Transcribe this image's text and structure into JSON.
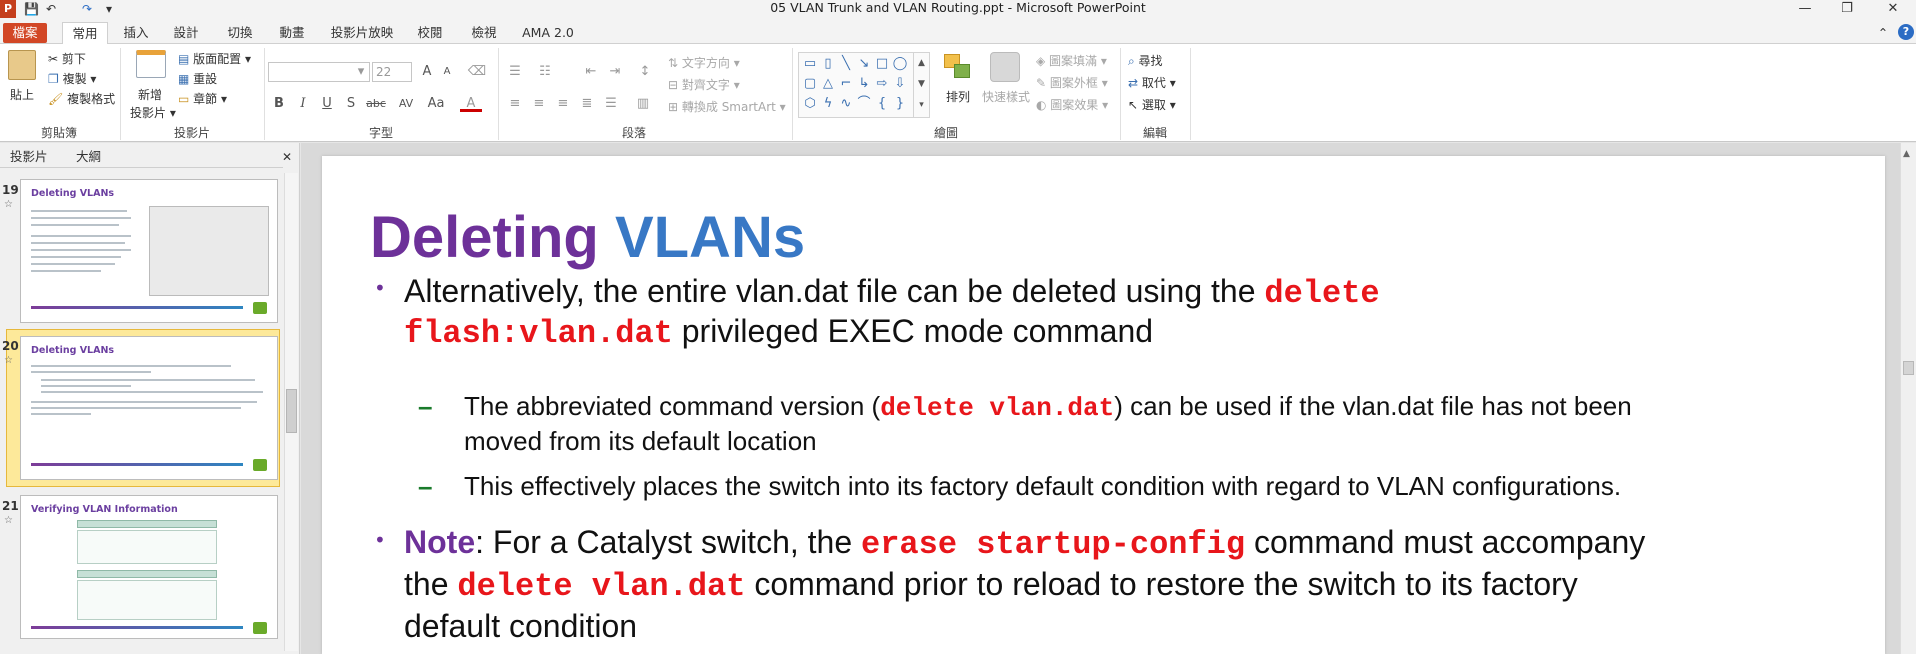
{
  "window": {
    "title": "05 VLAN Trunk and VLAN Routing.ppt - Microsoft PowerPoint",
    "min_glyph": "—",
    "restore_glyph": "❐",
    "close_glyph": "✕"
  },
  "qat": {
    "logo": "P",
    "save": "💾",
    "undo": "↶",
    "redo": "↷",
    "customize": "▾"
  },
  "tabs": {
    "file": "檔案",
    "home": "常用",
    "insert": "插入",
    "design": "設計",
    "transitions": "切換",
    "animations": "動畫",
    "slideshow": "投影片放映",
    "review": "校閱",
    "view": "檢視",
    "ama": "AMA 2.0",
    "ribbon_toggle": "⌃",
    "help": "?"
  },
  "clipboard": {
    "paste": "貼上",
    "cut": "剪下",
    "copy": "複製",
    "format_painter": "複製格式",
    "group": "剪貼簿"
  },
  "slides_group": {
    "new_slide_1": "新增",
    "new_slide_2": "投影片",
    "layout": "版面配置",
    "reset": "重設",
    "section": "章節",
    "group": "投影片"
  },
  "font": {
    "name_value": "",
    "size_value": "22",
    "bold": "B",
    "italic": "I",
    "underline": "U",
    "shadow": "S",
    "strike": "abc",
    "spacing": "AV",
    "case": "Aa",
    "color": "A",
    "grow": "A",
    "shrink": "A",
    "group": "字型"
  },
  "paragraph": {
    "text_direction": "文字方向",
    "align_text": "對齊文字",
    "smartart": "轉換成 SmartArt",
    "group": "段落"
  },
  "drawing": {
    "arrange": "排列",
    "quick_styles": "快速樣式",
    "shape_fill": "圖案填滿",
    "shape_outline": "圖案外框",
    "shape_effects": "圖案效果",
    "group": "繪圖"
  },
  "editing": {
    "find": "尋找",
    "replace": "取代",
    "select": "選取",
    "group": "編輯"
  },
  "panel": {
    "tab_slides": "投影片",
    "tab_outline": "大綱",
    "close": "✕",
    "thumbs": [
      {
        "num": "19",
        "title": "Deleting VLANs"
      },
      {
        "num": "20",
        "title": "Deleting VLANs"
      },
      {
        "num": "21",
        "title": "Verifying VLAN Information"
      }
    ]
  },
  "slide": {
    "title_a": "Deleting",
    "title_b": "VLANs",
    "b1_text": "Alternatively, the entire vlan.dat file can be deleted using the ",
    "b1_code1": "delete",
    "b1_code2": "flash:vlan.dat",
    "b1_text2": " privileged EXEC mode command",
    "s1_a": "The abbreviated command version (",
    "s1_code": "delete vlan.dat",
    "s1_b": ") can be used if the vlan.dat file has not been",
    "s1_c": "moved from its default location",
    "s2": "This effectively places the switch into its factory default condition with regard to VLAN configurations.",
    "note_label": "Note",
    "note_a": ": For a Catalyst switch, the ",
    "note_code1": "erase startup-config",
    "note_b": " command must accompany",
    "note_c": "the ",
    "note_code2": "delete vlan.dat",
    "note_d": " command prior to reload to restore the switch to its factory",
    "note_e": "default condition"
  }
}
